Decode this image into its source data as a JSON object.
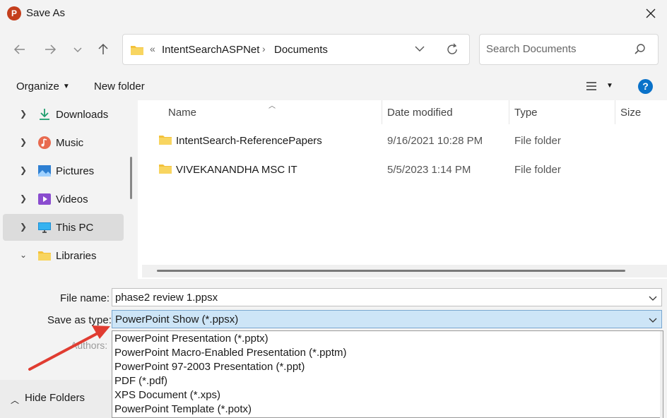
{
  "window": {
    "title": "Save As",
    "app_icon_letter": "P"
  },
  "nav": {
    "breadcrumb_overflow": "«",
    "breadcrumbs": [
      "IntentSearchASPNet",
      "Documents"
    ],
    "breadcrumb_separator": "›",
    "search_placeholder": "Search Documents"
  },
  "toolbar": {
    "organize_label": "Organize",
    "new_folder_label": "New folder",
    "help_label": "?"
  },
  "sidebar": {
    "items": [
      {
        "label": "Downloads",
        "icon": "downloads-icon"
      },
      {
        "label": "Music",
        "icon": "music-icon"
      },
      {
        "label": "Pictures",
        "icon": "pictures-icon"
      },
      {
        "label": "Videos",
        "icon": "videos-icon"
      },
      {
        "label": "This PC",
        "icon": "this-pc-icon",
        "selected": true
      },
      {
        "label": "Libraries",
        "icon": "libraries-icon",
        "expanded": true
      }
    ]
  },
  "files": {
    "columns": [
      "Name",
      "Date modified",
      "Type",
      "Size"
    ],
    "rows": [
      {
        "name": "IntentSearch-ReferencePapers",
        "date": "9/16/2021 10:28 PM",
        "type": "File folder"
      },
      {
        "name": "VIVEKANANDHA MSC IT",
        "date": "5/5/2023 1:14 PM",
        "type": "File folder"
      }
    ]
  },
  "form": {
    "file_name_label": "File name:",
    "file_name_value": "phase2 review 1.ppsx",
    "save_type_label": "Save as type:",
    "save_type_value": "PowerPoint Show (*.ppsx)",
    "authors_label": "Authors:"
  },
  "save_type_options": [
    "PowerPoint Presentation (*.pptx)",
    "PowerPoint Macro-Enabled Presentation (*.pptm)",
    "PowerPoint 97-2003 Presentation (*.ppt)",
    "PDF (*.pdf)",
    "XPS Document (*.xps)",
    "PowerPoint Template (*.potx)"
  ],
  "footer": {
    "hide_folders_label": "Hide Folders"
  },
  "colors": {
    "accent": "#0a72c9",
    "selection": "#cde5f7",
    "annotation_arrow": "#e03c31",
    "folder": "#f3c13a"
  }
}
